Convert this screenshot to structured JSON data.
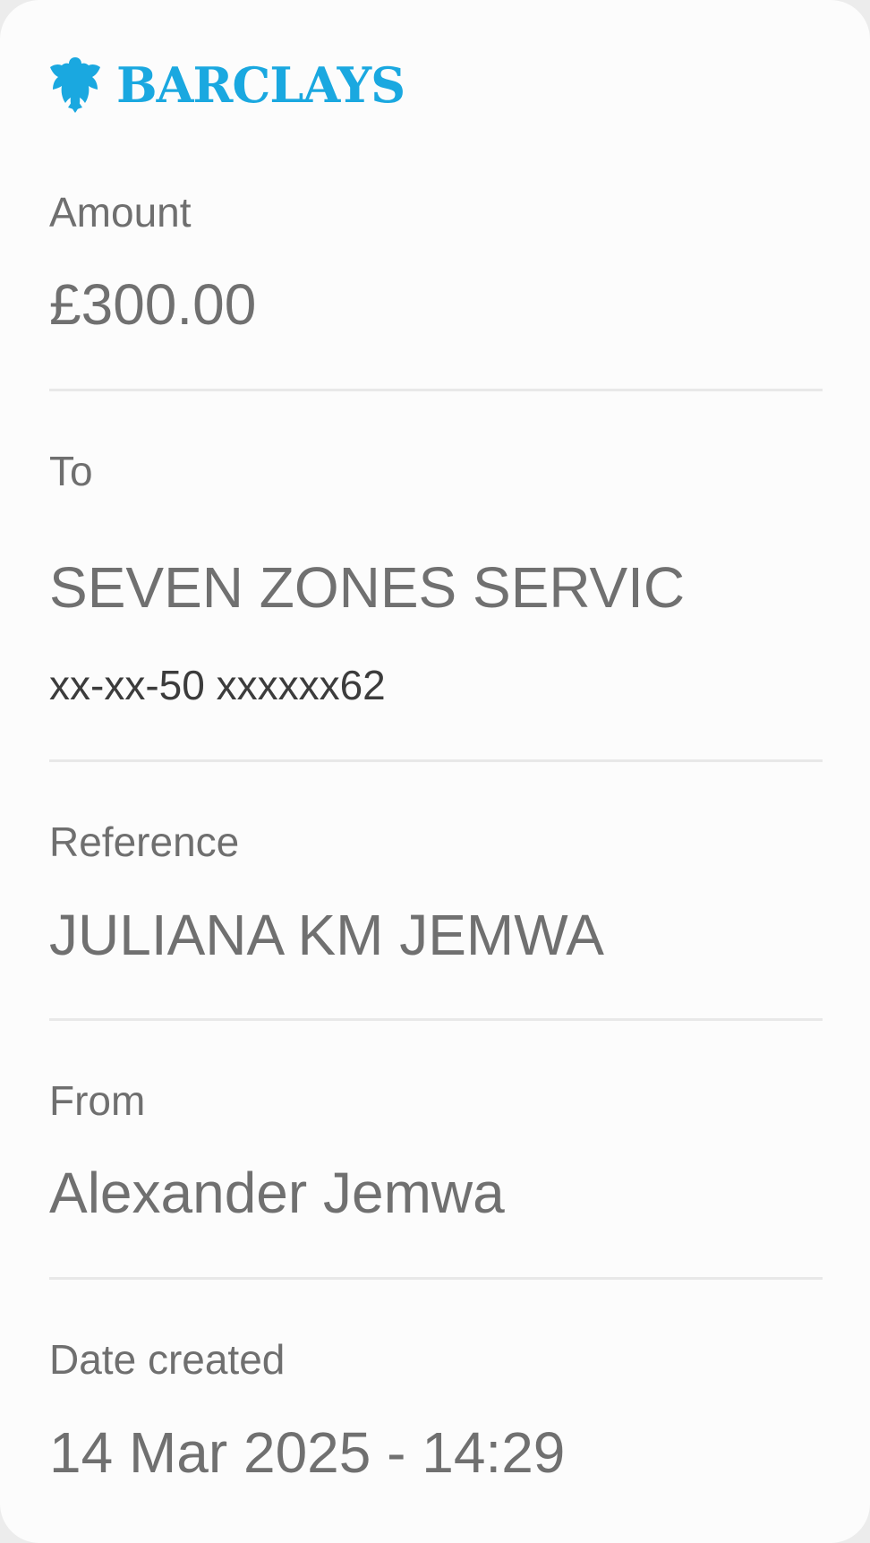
{
  "brand": {
    "name": "BARCLAYS",
    "icon": "eagle-icon",
    "color": "#1aa8e0"
  },
  "colors": {
    "label": "#6f6f6f",
    "value": "#707070",
    "subvalue": "#3c3c3c",
    "divider": "#e8e8e8"
  },
  "amount": {
    "label": "Amount",
    "value": "£300.00"
  },
  "to": {
    "label": "To",
    "name": "SEVEN ZONES SERVIC",
    "account": "xx-xx-50 xxxxxx62"
  },
  "reference": {
    "label": "Reference",
    "value": "JULIANA KM JEMWA"
  },
  "from": {
    "label": "From",
    "value": "Alexander Jemwa"
  },
  "date_created": {
    "label": "Date created",
    "value": "14 Mar 2025 - 14:29"
  }
}
